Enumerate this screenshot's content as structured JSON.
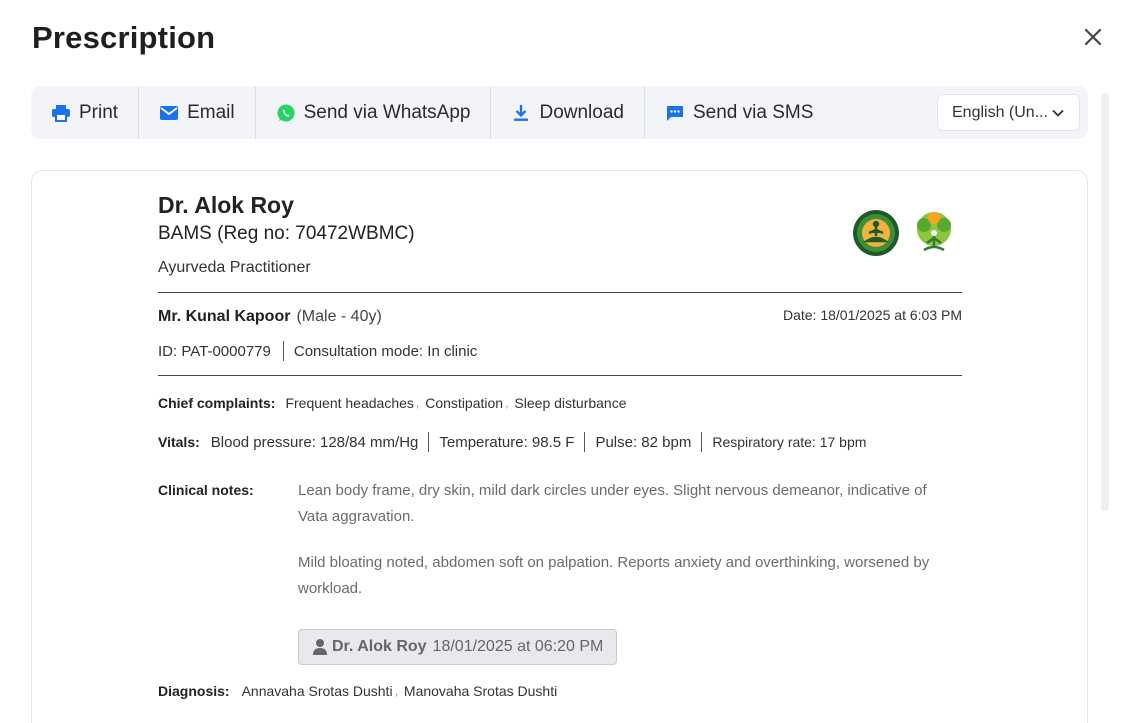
{
  "modal": {
    "title": "Prescription"
  },
  "toolbar": {
    "print_label": "Print",
    "email_label": "Email",
    "whatsapp_label": "Send via WhatsApp",
    "download_label": "Download",
    "sms_label": "Send via SMS",
    "language_value": "English (Un..."
  },
  "colors": {
    "accent": "#1a73e8",
    "whatsapp": "#25d366",
    "text": "#222222"
  },
  "doctor": {
    "name": "Dr. Alok Roy",
    "degree": "BAMS (Reg no: 70472WBMC)",
    "role": "Ayurveda Practitioner"
  },
  "patient": {
    "name": "Mr. Kunal Kapoor",
    "meta": "(Male - 40y)",
    "date": "Date: 18/01/2025 at 6:03 PM",
    "id": "ID: PAT-0000779",
    "mode": "Consultation mode: In clinic"
  },
  "chief_complaints": {
    "label": "Chief complaints:",
    "items": [
      "Frequent headaches",
      "Constipation",
      "Sleep disturbance"
    ]
  },
  "vitals": {
    "label": "Vitals:",
    "items": [
      "Blood pressure: 128/84 mm/Hg",
      "Temperature: 98.5 F",
      "Pulse: 82 bpm",
      "Respiratory rate: 17 bpm"
    ]
  },
  "clinical_notes": {
    "label": "Clinical notes:",
    "paragraphs": [
      "Lean body frame, dry skin, mild dark circles under eyes. Slight nervous demeanor, indicative of Vata aggravation.",
      "Mild bloating noted, abdomen soft on palpation. Reports anxiety and overthinking, worsened by workload."
    ],
    "author": "Dr. Alok Roy",
    "timestamp": "18/01/2025 at 06:20 PM"
  },
  "diagnosis": {
    "label": "Diagnosis:",
    "items": [
      "Annavaha Srotas Dushti",
      "Manovaha Srotas Dushti"
    ]
  }
}
